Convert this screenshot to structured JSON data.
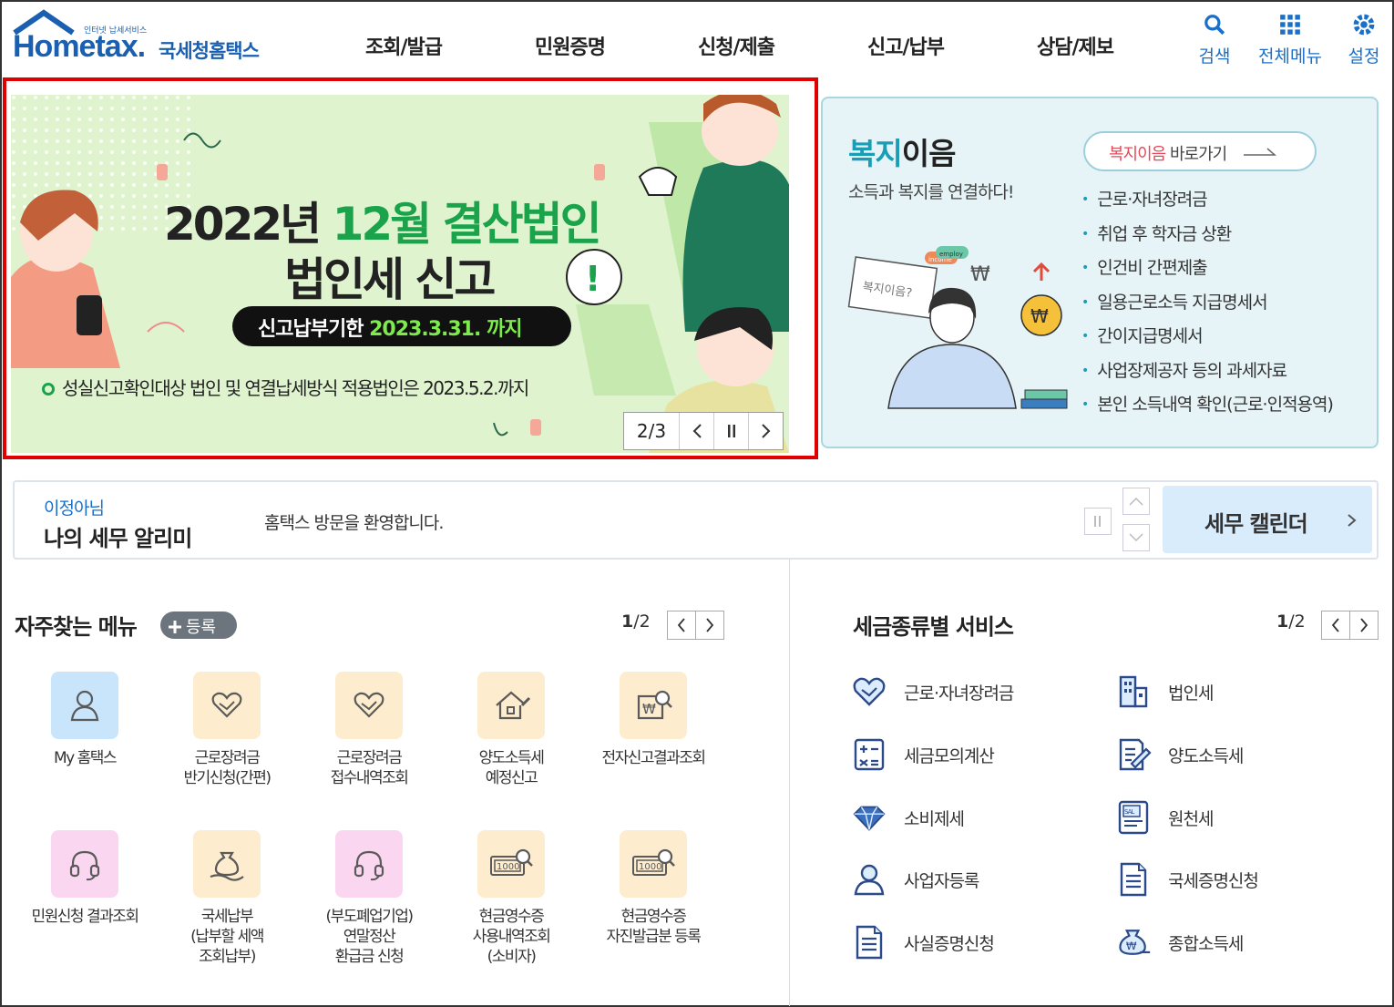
{
  "header": {
    "logo_small": "인터넷 납세서비스",
    "logo_main": "Hometax.",
    "logo_ko": "국세청홈택스",
    "nav": [
      "조회/발급",
      "민원증명",
      "신청/제출",
      "신고/납부",
      "상담/제보"
    ],
    "tools": {
      "search": "검색",
      "all_menu": "전체메뉴",
      "settings": "설정"
    }
  },
  "banner": {
    "title_line1_a": "2022년 ",
    "title_line1_b": "12월 결산법인",
    "title_line2": "법인세 신고",
    "deadline_label": "신고납부기한 ",
    "deadline_value": "2023.3.31. 까지",
    "note": "성실신고확인대상 법인 및 연결납세방식 적용법인은 2023.5.2.까지",
    "pager": "2/3",
    "bubble_mark": "!"
  },
  "welfare": {
    "title_a": "복지",
    "title_b": "이음",
    "subtitle": "소득과 복지를 연결하다!",
    "btn_a": "복지이음",
    "btn_b": " 바로가기",
    "items": [
      "근로·자녀장려금",
      "취업 후 학자금 상환",
      "인건비 간편제출",
      "일용근로소득 지급명세서",
      "간이지급명세서",
      "사업장제공자 등의 과세자료",
      "본인 소득내역 확인(근로·인적용역)"
    ],
    "illus_sign": "복지이음?",
    "illus_tag1": "employ",
    "illus_tag2": "income"
  },
  "alarm": {
    "user": "이정아님",
    "title": "나의 세무 알리미",
    "message": "홈택스 방문을 환영합니다.",
    "calendar": "세무 캘린더"
  },
  "fav": {
    "title": "자주찾는 메뉴",
    "register": "등록",
    "page_cur": "1",
    "page_total": "/2",
    "items": [
      {
        "label": "My 홈택스",
        "icon": "person-icon"
      },
      {
        "label": "근로장려금\n반기신청(간편)",
        "icon": "heart-hands-icon"
      },
      {
        "label": "근로장려금\n접수내역조회",
        "icon": "heart-hands-icon"
      },
      {
        "label": "양도소득세\n예정신고",
        "icon": "house-pen-icon"
      },
      {
        "label": "전자신고결과조회",
        "icon": "won-search-icon"
      },
      {
        "label": "민원신청 결과조회",
        "icon": "headset-icon"
      },
      {
        "label": "국세납부\n(납부할 세액\n조회납부)",
        "icon": "money-bag-hand-icon"
      },
      {
        "label": "(부도폐업기업)\n연말정산\n환급금 신청",
        "icon": "headset-icon"
      },
      {
        "label": "현금영수증\n사용내역조회\n(소비자)",
        "icon": "receipt-search-icon"
      },
      {
        "label": "현금영수증\n자진발급분 등록",
        "icon": "receipt-search-icon"
      }
    ],
    "receipt_amount": "1000"
  },
  "taxsvc": {
    "title": "세금종류별 서비스",
    "page_cur": "1",
    "page_total": "/2",
    "items": [
      {
        "label": "근로·자녀장려금",
        "icon": "heart-hands-icon"
      },
      {
        "label": "법인세",
        "icon": "building-icon"
      },
      {
        "label": "세금모의계산",
        "icon": "calculator-icon"
      },
      {
        "label": "양도소득세",
        "icon": "document-pen-icon"
      },
      {
        "label": "소비제세",
        "icon": "diamond-icon"
      },
      {
        "label": "원천세",
        "icon": "salary-doc-icon"
      },
      {
        "label": "사업자등록",
        "icon": "person-icon"
      },
      {
        "label": "국세증명신청",
        "icon": "document-icon"
      },
      {
        "label": "사실증명신청",
        "icon": "document-icon"
      },
      {
        "label": "종합소득세",
        "icon": "money-bag-icon"
      }
    ],
    "salary_mark": "SAL"
  },
  "colors": {
    "brand": "#1a5fb0",
    "green": "#1aa34a",
    "highlight": "#e00000",
    "welfare_accent": "#1a9eb6"
  }
}
